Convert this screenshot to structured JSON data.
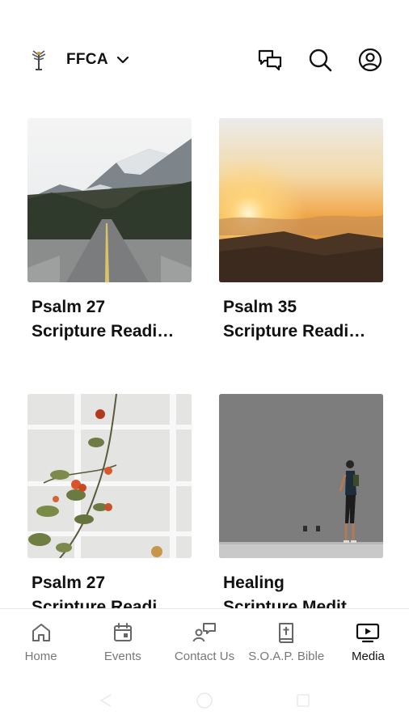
{
  "header": {
    "brand_name": "FFCA",
    "icons": [
      "logo-icon",
      "chevron-down-icon",
      "chat-icon",
      "search-icon",
      "profile-icon"
    ]
  },
  "cards": [
    {
      "line1": "Psalm 27",
      "line2": "Scripture Readi…",
      "image": "mountain-road"
    },
    {
      "line1": "Psalm 35",
      "line2": "Scripture Readi…",
      "image": "sunrise-clouds"
    },
    {
      "line1": "Psalm 27",
      "line2": "Scripture Readi…",
      "image": "flowers-trellis"
    },
    {
      "line1": "Healing",
      "line2": "Scripture Medit…",
      "image": "man-gray-wall"
    }
  ],
  "bottom_nav": {
    "items": [
      {
        "label": "Home",
        "icon": "home-icon",
        "active": false
      },
      {
        "label": "Events",
        "icon": "calendar-icon",
        "active": false
      },
      {
        "label": "Contact Us",
        "icon": "contact-icon",
        "active": false
      },
      {
        "label": "S.O.A.P. Bible",
        "icon": "bible-icon",
        "active": false
      },
      {
        "label": "Media",
        "icon": "media-icon",
        "active": true
      }
    ]
  },
  "colors": {
    "text": "#111111",
    "nav_inactive": "#777777",
    "background": "#ffffff"
  }
}
